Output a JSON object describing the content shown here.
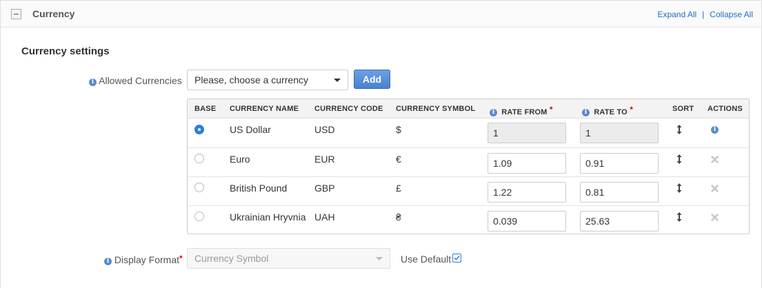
{
  "header": {
    "title": "Currency",
    "expand_all": "Expand All",
    "separator": "|",
    "collapse_all": "Collapse All"
  },
  "section_title": "Currency settings",
  "allowed_currencies": {
    "label": "Allowed Currencies",
    "select_value": "Please, choose a currency",
    "add_label": "Add"
  },
  "table": {
    "columns": {
      "base": "BASE",
      "name": "CURRENCY NAME",
      "code": "CURRENCY CODE",
      "symbol": "CURRENCY SYMBOL",
      "rate_from": "RATE FROM",
      "rate_to": "RATE TO",
      "sort": "SORT",
      "actions": "ACTIONS"
    },
    "required_mark": "*",
    "rows": [
      {
        "base": true,
        "name": "US Dollar",
        "code": "USD",
        "symbol": "$",
        "rate_from": "1",
        "rate_to": "1",
        "action_icon": "info-icon"
      },
      {
        "base": false,
        "name": "Euro",
        "code": "EUR",
        "symbol": "€",
        "rate_from": "1.09",
        "rate_to": "0.91",
        "action_icon": "delete-icon"
      },
      {
        "base": false,
        "name": "British Pound",
        "code": "GBP",
        "symbol": "£",
        "rate_from": "1.22",
        "rate_to": "0.81",
        "action_icon": "delete-icon"
      },
      {
        "base": false,
        "name": "Ukrainian Hryvnia",
        "code": "UAH",
        "symbol": "₴",
        "rate_from": "0.039",
        "rate_to": "25.63",
        "action_icon": "delete-icon"
      }
    ]
  },
  "display_format": {
    "label": "Display Format",
    "required_mark": "*",
    "select_value": "Currency Symbol",
    "use_default_label": "Use Default",
    "use_default_checked": true
  },
  "colors": {
    "link": "#1e6fc2",
    "accent": "#2b7fd9",
    "required": "#dd0000"
  }
}
